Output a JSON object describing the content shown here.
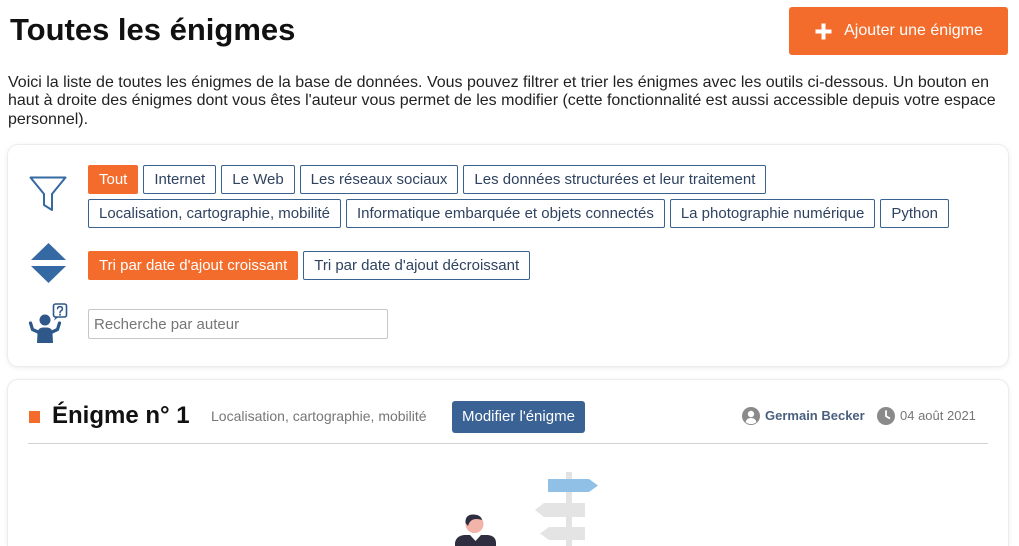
{
  "header": {
    "title": "Toutes les énigmes",
    "add_button_label": "Ajouter une énigme"
  },
  "intro": {
    "text": "Voici la liste de toutes les énigmes de la base de données. Vous pouvez filtrer et trier les énigmes avec les outils ci-dessous. Un bouton en haut à droite des énigmes dont vous êtes l'auteur vous permet de les modifier (cette fonctionnalité est aussi accessible depuis votre espace personnel)."
  },
  "filters": {
    "categories": [
      {
        "label": "Tout",
        "active": true
      },
      {
        "label": "Internet",
        "active": false
      },
      {
        "label": "Le Web",
        "active": false
      },
      {
        "label": "Les réseaux sociaux",
        "active": false
      },
      {
        "label": "Les données structurées et leur traitement",
        "active": false
      },
      {
        "label": "Localisation, cartographie, mobilité",
        "active": false
      },
      {
        "label": "Informatique embarquée et objets connectés",
        "active": false
      },
      {
        "label": "La photographie numérique",
        "active": false
      },
      {
        "label": "Python",
        "active": false
      }
    ],
    "sort_options": [
      {
        "label": "Tri par date d'ajout croissant",
        "active": true
      },
      {
        "label": "Tri par date d'ajout décroissant",
        "active": false
      }
    ],
    "author_search": {
      "value": "",
      "placeholder": "Recherche par auteur"
    }
  },
  "enigmas": [
    {
      "title": "Énigme n° 1",
      "category": "Localisation, cartographie, mobilité",
      "edit_label": "Modifier l'énigme",
      "author": "Germain Becker",
      "date": "04 août 2021"
    }
  ],
  "icons": {
    "add": "plus-icon",
    "filter": "funnel-icon",
    "sort": "sort-arrows-icon",
    "author_search": "person-question-icon",
    "author": "user-circle-icon",
    "date": "clock-icon"
  },
  "colors": {
    "accent": "#f36c2c",
    "chip_border": "#3a628f",
    "chip_text": "#2f4360",
    "edit_button": "#3a6294",
    "icon_blue": "#3569a3",
    "icon_dark_blue": "#2d5889",
    "author_name": "#4a5f7e",
    "muted_text": "#767676"
  }
}
